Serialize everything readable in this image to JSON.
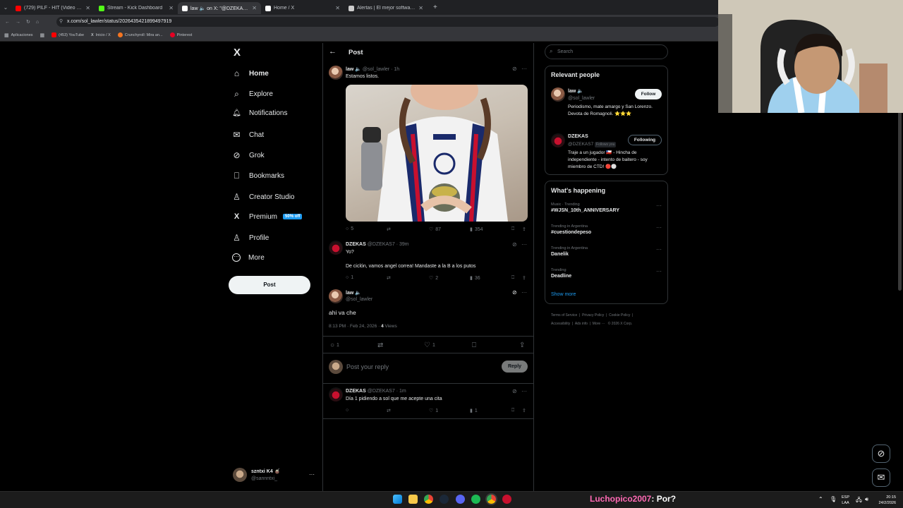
{
  "browser": {
    "tabs": [
      {
        "title": "(729) PILF - HIT (Video Oficial)",
        "favicon_color": "#ff0000",
        "active": false
      },
      {
        "title": "Stream - Kick Dashboard",
        "favicon_color": "#53fc18",
        "active": false
      },
      {
        "title": "law 🔈 on X: \"@DZEKAS7 ahi va",
        "favicon_color": "#ffffff",
        "active": true
      },
      {
        "title": "Home / X",
        "favicon_color": "#ffffff",
        "active": false
      },
      {
        "title": "Alertas | El mejor software para",
        "favicon_color": "#cccccc",
        "active": false
      }
    ],
    "url": "x.com/sol_lawler/status/2026435421899497919",
    "bookmarks": [
      "Aplicaciones",
      "(453) YouTube",
      "Inicio / X",
      "Crunchyroll: Mira an...",
      "Pinterest"
    ]
  },
  "sidebar": {
    "logo": "X",
    "items": [
      {
        "label": "Home",
        "icon": "home-icon",
        "glyph": "⌂"
      },
      {
        "label": "Explore",
        "icon": "search-icon",
        "glyph": "⌕"
      },
      {
        "label": "Notifications",
        "icon": "bell-icon",
        "glyph": "🔔︎"
      },
      {
        "label": "Chat",
        "icon": "mail-icon",
        "glyph": "✉"
      },
      {
        "label": "Grok",
        "icon": "grok-icon",
        "glyph": "⊘"
      },
      {
        "label": "Bookmarks",
        "icon": "bookmark-icon",
        "glyph": "⎕"
      },
      {
        "label": "Creator Studio",
        "icon": "creator-icon",
        "glyph": "♙"
      },
      {
        "label": "Premium",
        "icon": "x-logo-icon",
        "glyph": "X"
      },
      {
        "label": "Profile",
        "icon": "person-icon",
        "glyph": "♙"
      },
      {
        "label": "More",
        "icon": "more-icon",
        "glyph": "⋯"
      }
    ],
    "premium_badge": "50% off",
    "post_button": "Post",
    "account": {
      "name": "szntxi K4 🧉",
      "handle": "@sannntxi_",
      "more": "···"
    }
  },
  "main": {
    "back": "←",
    "header": "Post",
    "parent_post": {
      "name": "law 🔈",
      "handle": "@sol_lawler",
      "time": "· 1h",
      "text": "Estamos listos.",
      "replies": "5",
      "reposts": "",
      "likes": "87",
      "views": "354"
    },
    "reply1": {
      "name": "DZEKAS",
      "handle": "@DZEKAS7",
      "time": "· 39m",
      "line1": "Yo?",
      "line2": "De ciclón, vamos angel correa! Mandaste a la B a los putos",
      "replies": "1",
      "likes": "2",
      "views": "36"
    },
    "focused_post": {
      "name": "law 🔈",
      "handle": "@sol_lawler",
      "text": "ahi va che",
      "meta_time": "8:13 PM · Feb 24, 2026 ·",
      "views_count": "4",
      "views_label": "Views",
      "replies": "1",
      "likes": "1"
    },
    "composer": {
      "placeholder": "Post your reply",
      "button": "Reply"
    },
    "reply2": {
      "name": "DZEKAS",
      "handle": "@DZEKAS7",
      "time": "· 1m",
      "text": "Día 1 pidiendo a sol que me acepte una cita",
      "likes": "1",
      "views": "1"
    }
  },
  "right": {
    "search_placeholder": "Search",
    "relevant": {
      "title": "Relevant people",
      "people": [
        {
          "name": "law 🔈",
          "handle": "@sol_lawler",
          "bio": "Periodismo, mate amargo y San Lorenzo. Devota de Romagnoli. ⭐⭐⭐",
          "button": "Follow",
          "follows_you": ""
        },
        {
          "name": "DZEKAS",
          "handle": "@DZEKAS7",
          "bio": "Traje a un jugador 🇨🇱 - Hincha de independiente - intento de baitero - soy miembro de CTD! 🔴⚪",
          "button": "Following",
          "follows_you": "Follows you"
        }
      ]
    },
    "happening": {
      "title": "What's happening",
      "trends": [
        {
          "category": "Music · Trending",
          "name": "#WJSN_10th_ANNIVERSARY"
        },
        {
          "category": "Trending in Argentina",
          "name": "#cuestiondepeso"
        },
        {
          "category": "Trending in Argentina",
          "name": "Danelik"
        },
        {
          "category": "Trending",
          "name": "Deadline"
        }
      ],
      "show_more": "Show more"
    },
    "footer": [
      "Terms of Service",
      "Privacy Policy",
      "Cookie Policy",
      "Accessibility",
      "Ads info",
      "More ···",
      "© 2026 X Corp."
    ]
  },
  "overlay": {
    "chat_user": "Luchopico2007",
    "chat_message": ": Por?",
    "chat_user_color": "#ff69b4"
  },
  "taskbar": {
    "lang": "ESP",
    "lang2": "LAA",
    "time": "20:15",
    "date": "24/2/2026"
  }
}
